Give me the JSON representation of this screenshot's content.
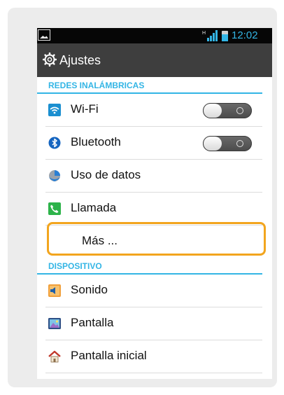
{
  "status_bar": {
    "time": "12:02",
    "signal_icon": "signal-bars-icon",
    "network_type": "H",
    "battery_icon": "battery-icon",
    "notification_icon": "image-notification-icon"
  },
  "action_bar": {
    "icon": "settings-gear-icon",
    "title": "Ajustes"
  },
  "sections": [
    {
      "header": "REDES INALÁMBRICAS",
      "items": [
        {
          "label": "Wi-Fi",
          "icon": "wifi-icon",
          "toggle": "off"
        },
        {
          "label": "Bluetooth",
          "icon": "bluetooth-icon",
          "toggle": "off"
        },
        {
          "label": "Uso de datos",
          "icon": "data-usage-icon"
        },
        {
          "label": "Llamada",
          "icon": "phone-call-icon"
        },
        {
          "label": "Más ...",
          "icon": "",
          "highlighted": true
        }
      ]
    },
    {
      "header": "DISPOSITIVO",
      "items": [
        {
          "label": "Sonido",
          "icon": "sound-icon"
        },
        {
          "label": "Pantalla",
          "icon": "display-icon"
        },
        {
          "label": "Pantalla inicial",
          "icon": "home-icon"
        }
      ]
    }
  ],
  "colors": {
    "accent": "#33b5e5",
    "highlight": "#f2a51e",
    "action_bar": "#3e3e3e"
  }
}
